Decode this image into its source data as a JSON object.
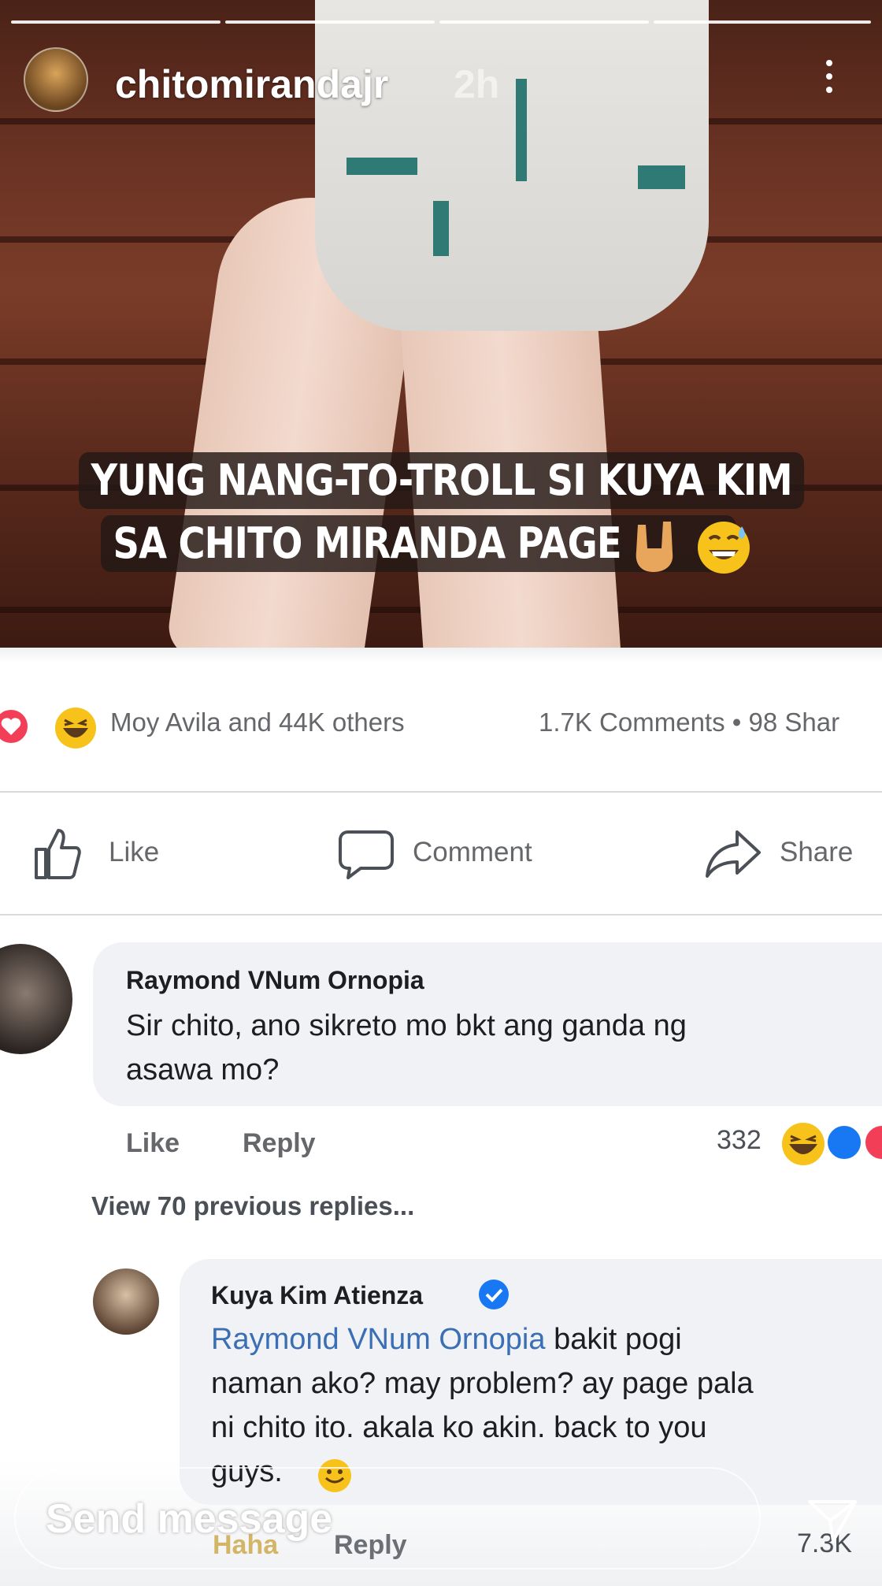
{
  "story": {
    "username": "chitomirandajr",
    "time": "2h",
    "caption_line1": "YUNG NANG-TO-TROLL SI KUYA KIM",
    "caption_line2": "SA CHITO MIRANDA PAGE",
    "send_message_placeholder": "Send message"
  },
  "post": {
    "reactions_text": "Moy Avila and 44K others",
    "comments_shares": "1.7K Comments • 98 Shar",
    "actions": {
      "like": "Like",
      "comment": "Comment",
      "share": "Share"
    }
  },
  "comments": [
    {
      "author": "Raymond VNum Ornopia",
      "text_line1": "Sir chito, ano sikreto mo bkt ang ganda ng",
      "text_line2": "asawa mo?",
      "like_label": "Like",
      "reply_label": "Reply",
      "reaction_count": "332"
    }
  ],
  "view_previous": "View 70 previous replies...",
  "reply": {
    "author": "Kuya Kim Atienza",
    "mention": "Raymond VNum Ornopia",
    "text_line1_rest": " bakit pogi",
    "text_line2": "naman ako? may problem? ay page pala",
    "text_line3": "ni chito ito. akala ko akin. back to you",
    "text_line4": "guys.",
    "haha_label": "Haha",
    "reply_label": "Reply",
    "reaction_count": "7.3K"
  },
  "icons": [
    "more-vertical-icon",
    "love-reaction-icon",
    "haha-reaction-icon",
    "like-thumb-icon",
    "comment-bubble-icon",
    "share-arrow-icon",
    "verified-badge-icon",
    "send-paper-plane-icon"
  ],
  "colors": {
    "fb_blue": "#1877f2",
    "love_red": "#f33e58",
    "link_blue": "#3a6fb5",
    "bubble_grey": "#f0f2f5"
  }
}
